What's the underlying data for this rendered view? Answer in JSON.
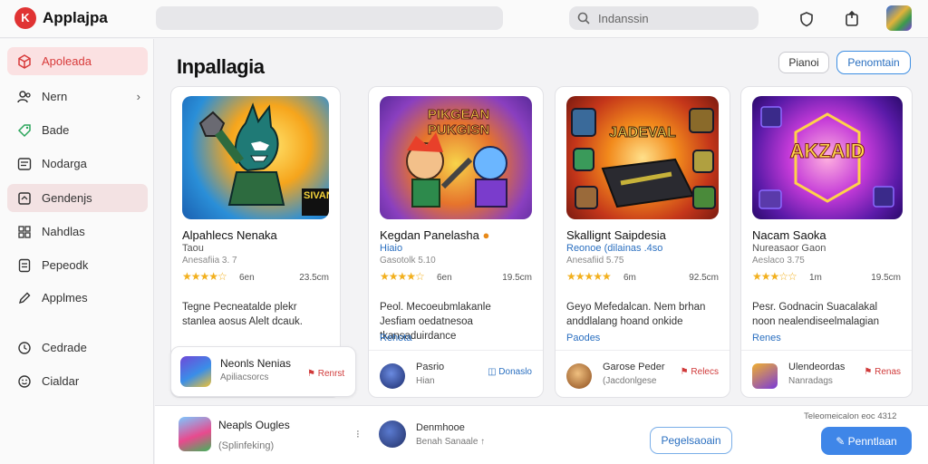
{
  "app": {
    "logo_glyph": "K",
    "title": "Applajpa",
    "brand_color": "#e03333"
  },
  "search": {
    "placeholder": "Indanssin"
  },
  "sidebar": {
    "items": [
      {
        "label": "Apoleada",
        "icon": "cube-icon",
        "state": "active"
      },
      {
        "label": "Nern",
        "icon": "people-icon",
        "has_chevron": true
      },
      {
        "label": "Bade",
        "icon": "tag-icon"
      },
      {
        "label": "Nodarga",
        "icon": "list-icon"
      },
      {
        "label": "Gendenjs",
        "icon": "frame-icon",
        "state": "selected"
      },
      {
        "label": "Nahdlas",
        "icon": "grid-icon"
      },
      {
        "label": "Pepeodk",
        "icon": "doc-icon"
      },
      {
        "label": "Applmes",
        "icon": "pen-icon"
      },
      {
        "label": "Cedrade",
        "icon": "clock-icon"
      },
      {
        "label": "Cialdar",
        "icon": "smile-icon"
      }
    ]
  },
  "main": {
    "title": "Inpallagia",
    "btn_plain": "Pianoi",
    "btn_outline": "Penomtain"
  },
  "cards": [
    {
      "art_text": "SIVANK",
      "name": "Alpahlecs Nenaka",
      "sub1": "Taou",
      "sub2": "Anesafiia 3. 7",
      "stars": "★★★★☆",
      "rating": "6en",
      "size": "23.5cm",
      "desc": "Tegne Pecneatalde plekr stanlea aosus Alelt dcauk.",
      "link": "",
      "foot": {
        "title": "Neonls Nenias",
        "sub": "Apiliacsorcs",
        "action": "Renrst"
      }
    },
    {
      "art_text": "PIKGEAN PUKGISN",
      "name": "Kegdan Panelasha",
      "sub1": "Hiaio",
      "sub2": "Gasotolk 5.10",
      "stars": "★★★★☆",
      "rating": "6en",
      "size": "19.5cm",
      "desc": "Peol. Mecoeubmlakanle Jesfiam oedatnesoa tkansaduirdance",
      "link": "Rehota",
      "foot": {
        "title": "Pasrio",
        "sub": "Hian",
        "action": "Donaslo"
      }
    },
    {
      "art_text": "JADEVAL",
      "name": "Skallignt Saipdesia",
      "sub1": "Reonoe (dilainas .4so",
      "sub2": "Anesafiid 5.75",
      "stars": "★★★★★",
      "rating": "6m",
      "size": "92.5cm",
      "desc": "Geyo Mefedalcan. Nem brhan anddlalang hoand onkide",
      "link": "Paodes",
      "foot": {
        "title": "Garose Peder",
        "sub": "(Jacdonlgese",
        "action": "Relecs"
      }
    },
    {
      "art_text": "AKZAID",
      "name": "Nacam Saoka",
      "sub1": "Nureasaor Gaon",
      "sub2": "Aeslaco 3.75",
      "stars": "★★★☆☆",
      "rating": "1m",
      "size": "19.5cm",
      "desc": "Pesr. Godnacin Suacalakal noon nealendiseelmalagian",
      "link": "Renes",
      "foot": {
        "title": "Ulendeordas",
        "sub": "Nanradags",
        "action": "Renas"
      }
    }
  ],
  "bottom": {
    "title": "Neapls Ougles",
    "sub": "(Splinfeking)",
    "dot": "⁝",
    "user_title": "Denmhooe",
    "user_sub": "Benah Sanaale ↑",
    "btn1": "Pegelsaoain",
    "note": "Teleomeicalon eoc 4312",
    "btn2": "Penntlaan"
  }
}
